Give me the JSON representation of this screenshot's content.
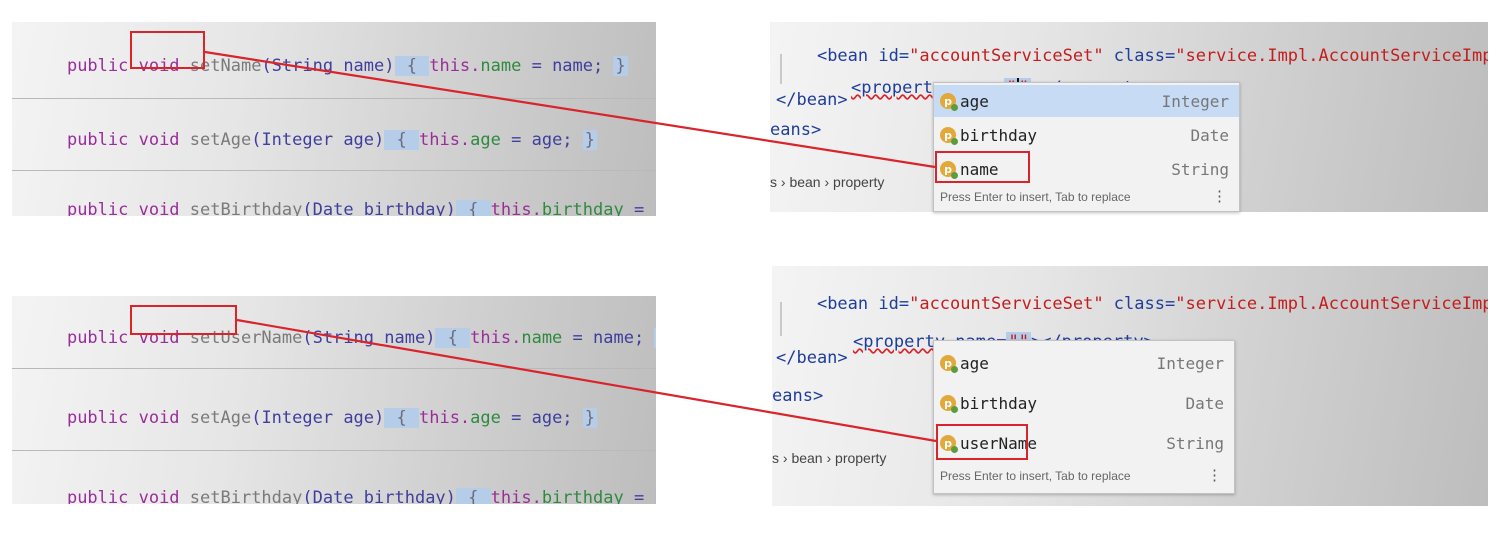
{
  "top": {
    "code": {
      "line1": {
        "kw": "public void ",
        "method": "setName",
        "params": "(String name)",
        "body_open": " { ",
        "this": "this.",
        "field": "name",
        "rest": " = name; ",
        "close": "}"
      },
      "line2": {
        "kw": "public void ",
        "method": "setAge",
        "params": "(Integer age)",
        "body_open": " { ",
        "this": "this.",
        "field": "age",
        "rest": " = age; ",
        "close": "}"
      },
      "line3": {
        "kw": "public void ",
        "method": "setBirthday",
        "params": "(Date birthday)",
        "body_open": " { ",
        "this": "this.",
        "field": "birthday",
        "rest": " = birthday; ",
        "close": "}"
      }
    },
    "xml": {
      "bean_open": "<bean ",
      "id_attr": "id=",
      "id_val": "\"accountServiceSet\"",
      "class_attr": " class=",
      "class_val": "\"service.Impl.AccountServiceImplSet\"",
      "bean_close_gt": ">",
      "prop_open": "<property name=",
      "prop_q1": "\"",
      "prop_q2": "\"",
      "prop_close": "></property>",
      "end_bean": "</bean>",
      "end_beans": "eans>",
      "breadcrumb": "s  ›  bean  ›  property"
    },
    "popup": {
      "items": [
        {
          "name": "age",
          "type": "Integer"
        },
        {
          "name": "birthday",
          "type": "Date"
        },
        {
          "name": "name",
          "type": "String"
        }
      ],
      "hint": "Press Enter to insert, Tab to replace",
      "more": "⋮"
    }
  },
  "bottom": {
    "code": {
      "line1": {
        "kw": "public void ",
        "method": "setUserName",
        "params": "(String name)",
        "body_open": " { ",
        "this": "this.",
        "field": "name",
        "rest": " = name; ",
        "close": "}"
      },
      "line2": {
        "kw": "public void ",
        "method": "setAge",
        "params": "(Integer age)",
        "body_open": " { ",
        "this": "this.",
        "field": "age",
        "rest": " = age; ",
        "close": "}"
      },
      "line3": {
        "kw": "public void ",
        "method": "setBirthday",
        "params": "(Date birthday)",
        "body_open": " { ",
        "this": "this.",
        "field": "birthday",
        "rest": " = birthday; ",
        "close": "}"
      }
    },
    "xml": {
      "bean_open": "<bean ",
      "id_attr": "id=",
      "id_val": "\"accountServiceSet\"",
      "class_attr": " class=",
      "class_val": "\"service.Impl.AccountServiceImplSet\"",
      "bean_close_gt": ">",
      "prop_open": "<property name=",
      "prop_q1": "\"\"",
      "prop_close": "></property>",
      "end_bean": "</bean>",
      "end_beans": "eans>",
      "breadcrumb": "s  ›  bean  ›  property"
    },
    "popup": {
      "items": [
        {
          "name": "age",
          "type": "Integer"
        },
        {
          "name": "birthday",
          "type": "Date"
        },
        {
          "name": "userName",
          "type": "String"
        }
      ],
      "hint": "Press Enter to insert, Tab to replace",
      "more": "⋮"
    }
  },
  "colors": {
    "highlight_box": "#d9242c",
    "arrow": "#d9242c",
    "selection": "#c7dbf5"
  },
  "icons": {
    "property_item": "property-icon",
    "more": "more-vertical-icon"
  }
}
